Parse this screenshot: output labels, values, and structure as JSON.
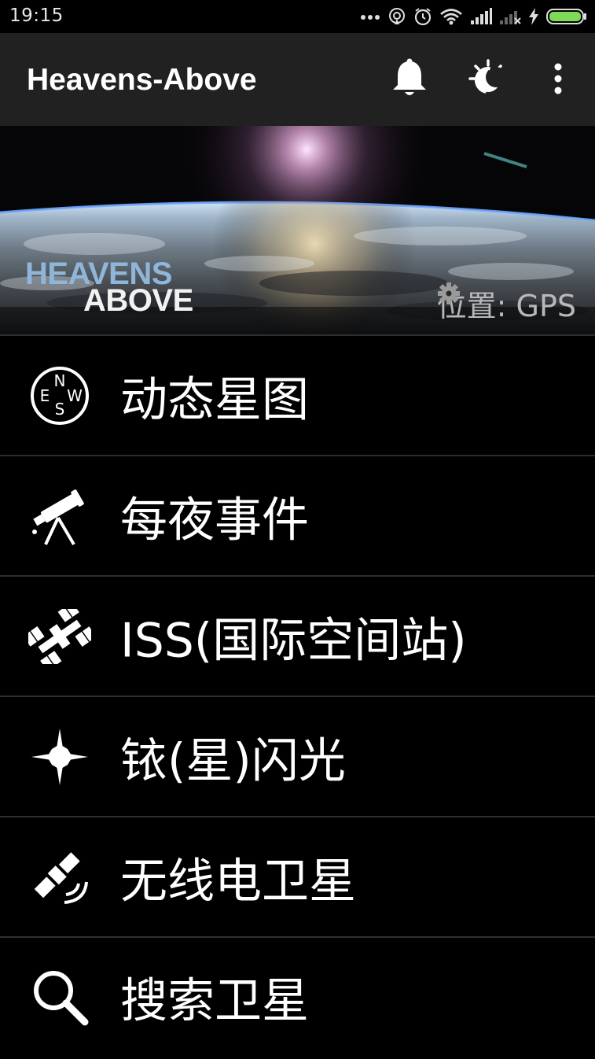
{
  "status_bar": {
    "time": "19:15",
    "icons": [
      "more-dots-icon",
      "hotspot-icon",
      "alarm-icon",
      "wifi-icon",
      "signal-icon",
      "signal-no-service-icon",
      "charging-bolt-icon",
      "battery-icon"
    ],
    "battery_color": "#7ed957"
  },
  "app_bar": {
    "title": "Heavens-Above",
    "actions": [
      "notification-bell-icon",
      "night-mode-icon",
      "overflow-menu-icon"
    ],
    "background": "#212121"
  },
  "banner": {
    "logo_line1": "HEAVENS",
    "logo_line2": "ABOVE",
    "location_label": "位置: GPS",
    "location_settings_icon": "gear-icon"
  },
  "menu": {
    "items": [
      {
        "label": "动态星图",
        "icon": "compass-icon"
      },
      {
        "label": "每夜事件",
        "icon": "telescope-icon"
      },
      {
        "label": "ISS(国际空间站)",
        "icon": "space-station-icon"
      },
      {
        "label": "铱(星)闪光",
        "icon": "flare-star-icon"
      },
      {
        "label": "无线电卫星",
        "icon": "radio-satellite-icon"
      },
      {
        "label": "搜索卫星",
        "icon": "search-icon"
      }
    ]
  }
}
